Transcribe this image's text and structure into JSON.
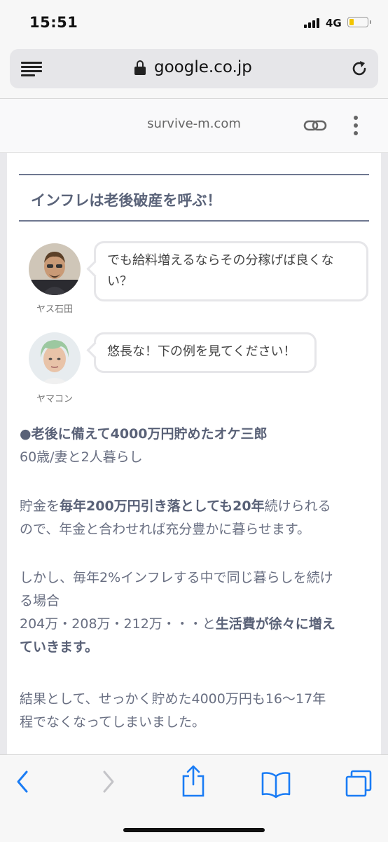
{
  "status": {
    "time": "15:51",
    "network": "4G"
  },
  "browser": {
    "domain": "google.co.jp"
  },
  "site": {
    "name": "survive-m.com"
  },
  "article": {
    "heading": "インフレは老後破産を呼ぶ！",
    "chat": [
      {
        "name": "ヤス石田",
        "line1": "でも給料増えるならその分稼げば良くな",
        "line2": "い？"
      },
      {
        "name": "ヤマコン",
        "line1": "悠長な！下の例を見てください！"
      }
    ],
    "p1": {
      "bold": "●老後に備えて4000万円貯めたオケ三郎",
      "text": "60歳/妻と2人暮らし"
    },
    "p2": {
      "a": "貯金を",
      "b1": "毎年200万円引き落としても20年",
      "c": "続けられる",
      "line2": "ので、年金と合わせれば充分豊かに暮らせます。"
    },
    "p3": {
      "line1": "しかし、毎年2%インフレする中で同じ暮らしを続け",
      "line2": "る場合",
      "line3a": "204万・208万・212万・・・と",
      "line3b": "生活費が徐々に増え",
      "line4": "ていきます。"
    },
    "p4": {
      "line1": "結果として、せっかく貯めた4000万円も16〜17年",
      "line2": "程でなくなってしまいました。"
    }
  },
  "colors": {
    "heading": "#5a6379",
    "text": "#696f82",
    "accent": "#1a7cf5"
  },
  "icons": [
    "reader-icon",
    "lock-icon",
    "reload-icon",
    "link-icon",
    "more-icon",
    "back-icon",
    "forward-icon",
    "share-icon",
    "bookmarks-icon",
    "tabs-icon"
  ]
}
